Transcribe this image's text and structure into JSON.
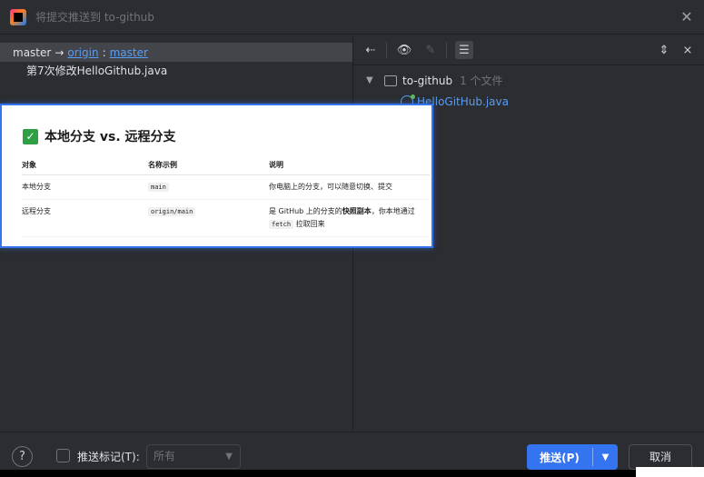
{
  "window": {
    "title": "将提交推送到 to-github"
  },
  "left": {
    "branch_local": "master",
    "arrow": "→",
    "remote": "origin",
    "colon": ":",
    "remote_branch": "master",
    "commit_message": "第7次修改HelloGithub.java"
  },
  "right": {
    "tree": {
      "repo_name": "to-github",
      "repo_count": "1 个文件",
      "file_name": "HelloGitHub.java"
    }
  },
  "card": {
    "title": "本地分支 vs. 远程分支",
    "headers": [
      "对象",
      "名称示例",
      "说明"
    ],
    "rows": [
      {
        "object": "本地分支",
        "example": "main",
        "desc_pre": "你电脑上的分支，可以随意切换、提交",
        "desc_bold": "",
        "desc_post": "",
        "desc_code": "",
        "desc_tail": ""
      },
      {
        "object": "远程分支",
        "example": "origin/main",
        "desc_pre": "是 GitHub 上的分支的",
        "desc_bold": "快照副本",
        "desc_post": "，你本地通过",
        "desc_code": "fetch",
        "desc_tail": "拉取回来"
      }
    ]
  },
  "bottom": {
    "help": "?",
    "checkbox_label": "推送标记(T):",
    "select_value": "所有",
    "push_label": "推送(P)",
    "cancel_label": "取消"
  },
  "colors": {
    "accent": "#3574f0",
    "link": "#589df6",
    "check": "#2ea043"
  }
}
